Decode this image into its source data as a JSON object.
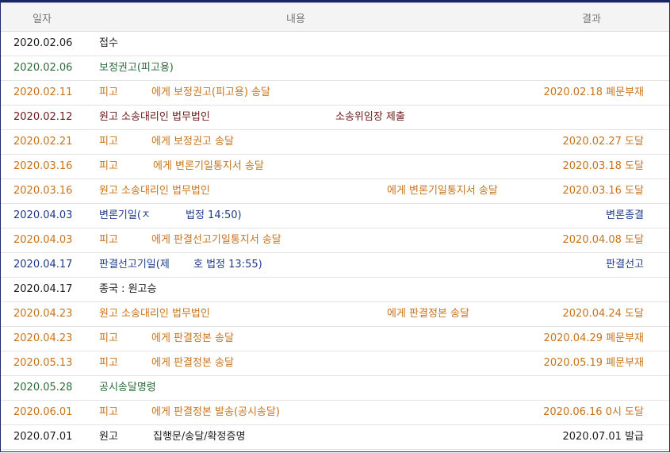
{
  "header": {
    "date": "일자",
    "content": "내용",
    "result": "결과"
  },
  "rows": [
    {
      "date": "2020.02.06",
      "p1": "접수",
      "p2": "",
      "result": "",
      "color": "black"
    },
    {
      "date": "2020.02.06",
      "p1": "보정권고(피고용)",
      "p2": "",
      "result": "",
      "color": "green"
    },
    {
      "date": "2020.02.11",
      "p1": "피고",
      "p2": "에게 보정권고(피고용) 송달",
      "result": "2020.02.18 폐문부재",
      "color": "orange"
    },
    {
      "date": "2020.02.12",
      "p1": "원고 소송대리인 법무법인",
      "p2": "소송위임장 제출",
      "result": "",
      "color": "maroon"
    },
    {
      "date": "2020.02.21",
      "p1": "피고",
      "p2": "에게 보정권고 송달",
      "result": "2020.02.27 도달",
      "color": "orange"
    },
    {
      "date": "2020.03.16",
      "p1": "피고",
      "p2": "에게 변론기일통지서 송달",
      "result": "2020.03.18 도달",
      "color": "orange"
    },
    {
      "date": "2020.03.16",
      "p1": "원고 소송대리인 법무법인",
      "p2": "에게 변론기일통지서 송달",
      "result": "2020.03.16 도달",
      "color": "orange"
    },
    {
      "date": "2020.04.03",
      "p1": "변론기일(ㅈ",
      "p2": "법정 14:50)",
      "result": "변론종결",
      "color": "blue"
    },
    {
      "date": "2020.04.03",
      "p1": "피고",
      "p2": "에게 판결선고기일통지서 송달",
      "result": "2020.04.08 도달",
      "color": "orange"
    },
    {
      "date": "2020.04.17",
      "p1": "판결선고기일(제",
      "p2": "호 법정 13:55)",
      "result": "판결선고",
      "color": "blue"
    },
    {
      "date": "2020.04.17",
      "p1": "종국 : 원고승",
      "p2": "",
      "result": "",
      "color": "black"
    },
    {
      "date": "2020.04.23",
      "p1": "원고 소송대리인 법무법인",
      "p2": "에게 판결정본 송달",
      "result": "2020.04.24 도달",
      "color": "orange"
    },
    {
      "date": "2020.04.23",
      "p1": "피고",
      "p2": "에게 판결정본 송달",
      "result": "2020.04.29 폐문부재",
      "color": "orange"
    },
    {
      "date": "2020.05.13",
      "p1": "피고",
      "p2": "에게 판결정본 송달",
      "result": "2020.05.19 폐문부재",
      "color": "orange"
    },
    {
      "date": "2020.05.28",
      "p1": "공시송달명령",
      "p2": "",
      "result": "",
      "color": "green"
    },
    {
      "date": "2020.06.01",
      "p1": "피고",
      "p2": "에게 판결정본 발송(공시송달)",
      "result": "2020.06.16 0시 도달",
      "color": "orange"
    },
    {
      "date": "2020.07.01",
      "p1": "원고",
      "p2": "집행문/송달/확정증명",
      "result": "2020.07.01 발급",
      "color": "black"
    }
  ]
}
